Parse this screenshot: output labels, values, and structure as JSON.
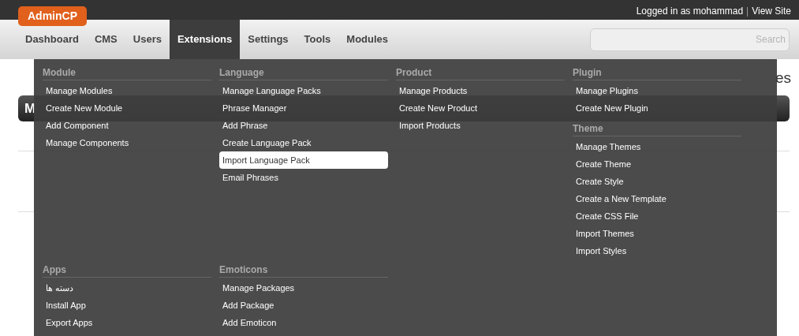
{
  "brand": "AdminCP",
  "top_links": {
    "user": "Logged in as mohammad",
    "separator": "|",
    "view_site": "View Site"
  },
  "nav": [
    {
      "label": "Dashboard",
      "selected": false
    },
    {
      "label": "CMS",
      "selected": false
    },
    {
      "label": "Users",
      "selected": false
    },
    {
      "label": "Extensions",
      "selected": true
    },
    {
      "label": "Settings",
      "selected": false
    },
    {
      "label": "Tools",
      "selected": false
    },
    {
      "label": "Modules",
      "selected": false
    }
  ],
  "search": {
    "placeholder": "Search"
  },
  "page": {
    "title": "es",
    "panel_title": "M"
  },
  "menu": {
    "top": [
      [
        {
          "title": "Module",
          "items": [
            {
              "label": "Manage Modules",
              "selected": false
            },
            {
              "label": "Create New Module",
              "selected": false
            },
            {
              "label": "Add Component",
              "selected": false
            },
            {
              "label": "Manage Components",
              "selected": false
            }
          ]
        }
      ],
      [
        {
          "title": "Language",
          "items": [
            {
              "label": "Manage Language Packs",
              "selected": false
            },
            {
              "label": "Phrase Manager",
              "selected": false
            },
            {
              "label": "Add Phrase",
              "selected": false
            },
            {
              "label": "Create Language Pack",
              "selected": false
            },
            {
              "label": "Import Language Pack",
              "selected": true
            },
            {
              "label": "Email Phrases",
              "selected": false
            }
          ]
        }
      ],
      [
        {
          "title": "Product",
          "items": [
            {
              "label": "Manage Products",
              "selected": false
            },
            {
              "label": "Create New Product",
              "selected": false
            },
            {
              "label": "Import Products",
              "selected": false
            }
          ]
        }
      ],
      [
        {
          "title": "Plugin",
          "items": [
            {
              "label": "Manage Plugins",
              "selected": false
            },
            {
              "label": "Create New Plugin",
              "selected": false
            }
          ]
        },
        {
          "title": "Theme",
          "items": [
            {
              "label": "Manage Themes",
              "selected": false
            },
            {
              "label": "Create Theme",
              "selected": false
            },
            {
              "label": "Create Style",
              "selected": false
            },
            {
              "label": "Create a New Template",
              "selected": false
            },
            {
              "label": "Create CSS File",
              "selected": false
            },
            {
              "label": "Import Themes",
              "selected": false
            },
            {
              "label": "Import Styles",
              "selected": false
            }
          ]
        }
      ]
    ],
    "bottom": [
      {
        "title": "Apps",
        "items": [
          {
            "label": "دسته ها",
            "selected": false
          },
          {
            "label": "Install App",
            "selected": false
          },
          {
            "label": "Export Apps",
            "selected": false
          }
        ]
      },
      {
        "title": "Emoticons",
        "items": [
          {
            "label": "Manage Packages",
            "selected": false
          },
          {
            "label": "Add Package",
            "selected": false
          },
          {
            "label": "Add Emoticon",
            "selected": false
          }
        ]
      }
    ]
  }
}
